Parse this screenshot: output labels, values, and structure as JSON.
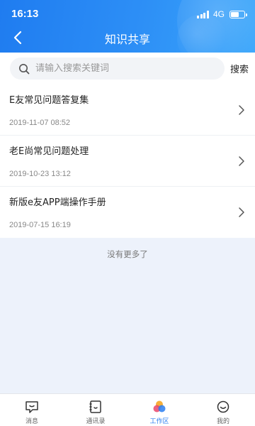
{
  "status_bar": {
    "time": "16:13",
    "network": "4G"
  },
  "nav": {
    "title": "知识共享"
  },
  "search": {
    "placeholder": "请输入搜索关键词",
    "value": "",
    "button_label": "搜索"
  },
  "articles": [
    {
      "title": "E友常见问题答复集",
      "date": "2019-11-07 08:52"
    },
    {
      "title": "老E尚常见问题处理",
      "date": "2019-10-23 13:12"
    },
    {
      "title": "新版e友APP端操作手册",
      "date": "2019-07-15 16:19"
    }
  ],
  "footer_text": "没有更多了",
  "tab_bar": {
    "active": "工作区",
    "tabs": [
      {
        "label": "消息",
        "icon": "message-icon"
      },
      {
        "label": "通讯录",
        "icon": "contacts-icon"
      },
      {
        "label": "工作区",
        "icon": "workspace-icon"
      },
      {
        "label": "我的",
        "icon": "profile-icon"
      }
    ]
  },
  "colors": {
    "header": "#2d8ff6",
    "accent": "#2a7ef0",
    "background": "#edf2fb"
  }
}
